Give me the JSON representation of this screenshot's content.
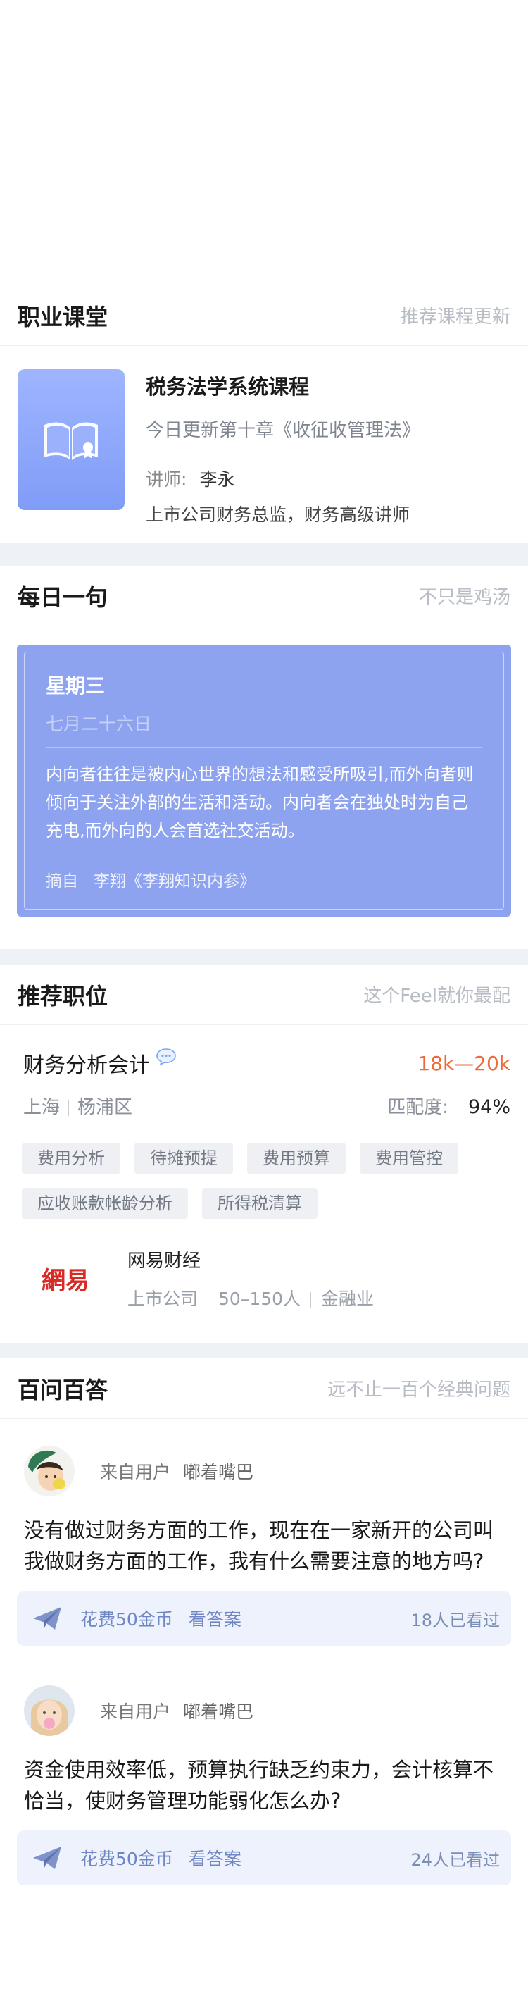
{
  "course_section": {
    "title": "职业课堂",
    "subtitle": "推荐课程更新",
    "course": {
      "name": "税务法学系统课程",
      "update": "今日更新第十章《收征收管理法》",
      "teacher_label": "讲师:",
      "teacher_name": "李永",
      "teacher_desc": "上市公司财务总监，财务高级讲师",
      "cover_icon": "book-icon"
    }
  },
  "quote_section": {
    "title": "每日一句",
    "subtitle": "不只是鸡汤",
    "weekday": "星期三",
    "date": "七月二十六日",
    "text": "内向者往往是被内心世界的想法和感受所吸引,而外向者则倾向于关注外部的生活和活动。内向者会在独处时为自己充电,而外向的人会首选社交活动。",
    "source_label": "摘自",
    "source": "李翔《李翔知识内参》",
    "card_color": "#8da3ef"
  },
  "job_section": {
    "title": "推荐职位",
    "subtitle": "这个Feel就你最配",
    "job": {
      "title": "财务分析会计",
      "salary": "18k—20k",
      "city": "上海",
      "district": "杨浦区",
      "match_label": "匹配度:",
      "match_value": "94%",
      "tags": [
        "费用分析",
        "待摊预提",
        "费用预算",
        "费用管控",
        "应收账款帐龄分析",
        "所得税清算"
      ],
      "company": {
        "logo_text": "網易",
        "name": "网易财经",
        "type": "上市公司",
        "size": "50–150人",
        "industry": "金融业"
      }
    },
    "salary_color": "#ee6a3a"
  },
  "qa_section": {
    "title": "百问百答",
    "subtitle": "远不止一百个经典问题",
    "items": [
      {
        "from_label": "来自用户",
        "nickname": "嘟着嘴巴",
        "question": "没有做过财务方面的工作，现在在一家新开的公司叫我做财务方面的工作，我有什么需要注意的地方吗?",
        "cost": "花费50金币",
        "see_answer": "看答案",
        "viewed": "18人已看过"
      },
      {
        "from_label": "来自用户",
        "nickname": "嘟着嘴巴",
        "question": "资金使用效率低，预算执行缺乏约束力，会计核算不恰当，使财务管理功能弱化怎么办?",
        "cost": "花费50金币",
        "see_answer": "看答案",
        "viewed": "24人已看过"
      }
    ]
  }
}
